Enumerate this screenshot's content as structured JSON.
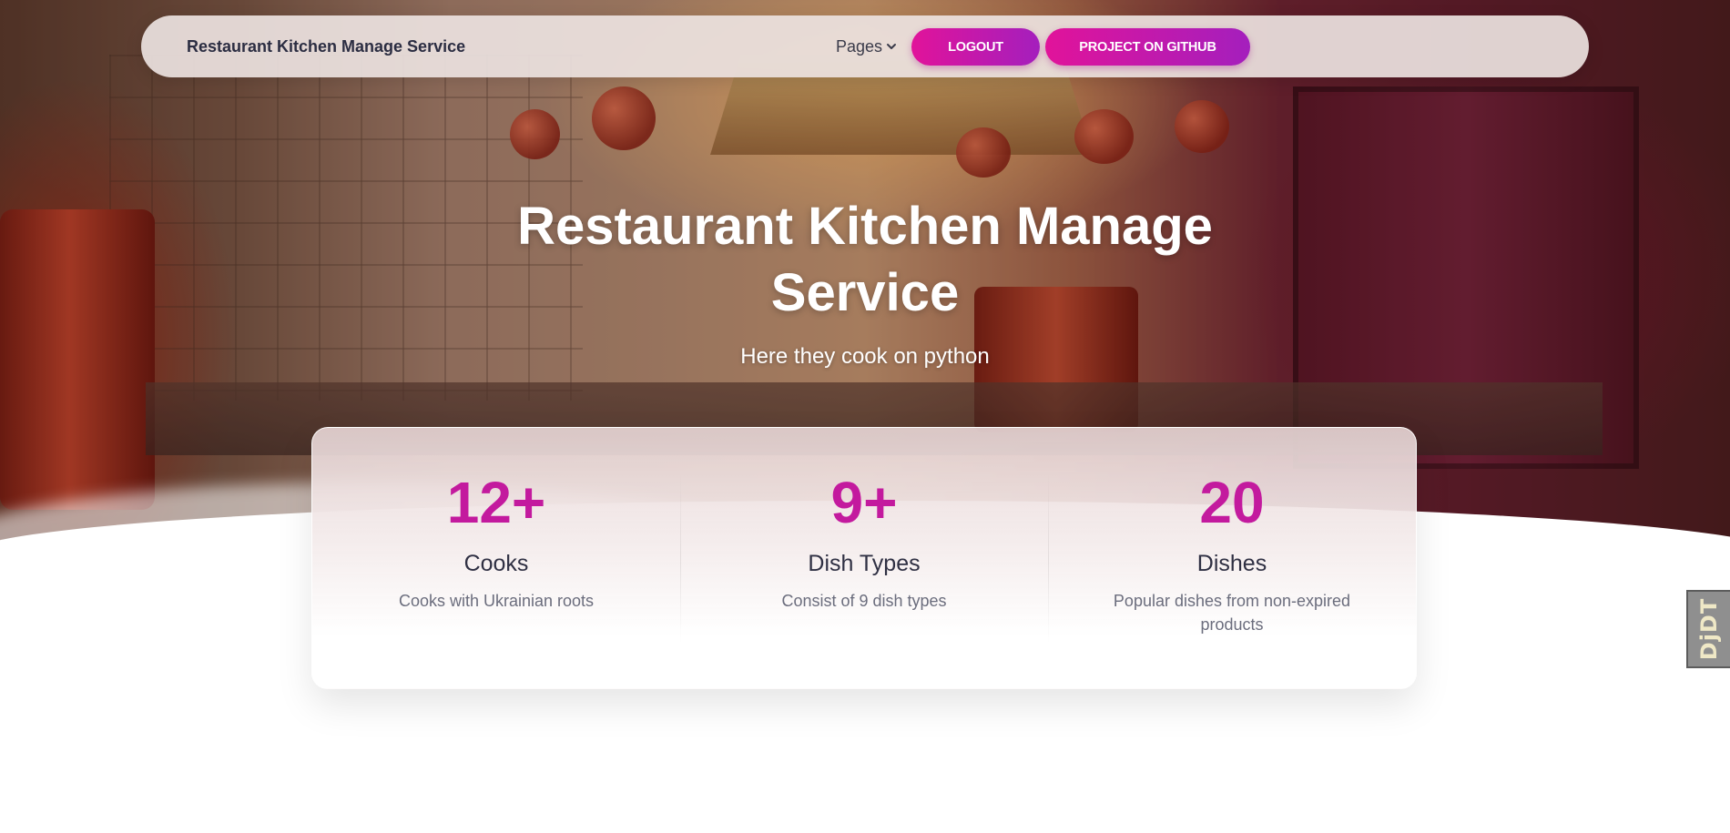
{
  "navbar": {
    "brand": "Restaurant Kitchen Manage Service",
    "pages_label": "Pages",
    "pages_icon": "chevron-down-icon",
    "logout_label": "LOGOUT",
    "github_label": "PROJECT ON GITHUB"
  },
  "hero": {
    "title_line1": "Restaurant Kitchen Manage",
    "title_line2": "Service",
    "subtitle": "Here they cook on python"
  },
  "stats": [
    {
      "value": "12+",
      "title": "Cooks",
      "description": "Cooks with Ukrainian roots"
    },
    {
      "value": "9+",
      "title": "Dish Types",
      "description": "Consist of 9 dish types"
    },
    {
      "value": "20",
      "title": "Dishes",
      "description": "Popular dishes from non-expired products"
    }
  ],
  "side_badge": {
    "text": "DjDT"
  },
  "colors": {
    "accent_start": "#e1139a",
    "accent_end": "#a41fbd",
    "stat_value": "#c31a9e",
    "heading": "#2f3043",
    "muted": "#6b6d7d"
  }
}
